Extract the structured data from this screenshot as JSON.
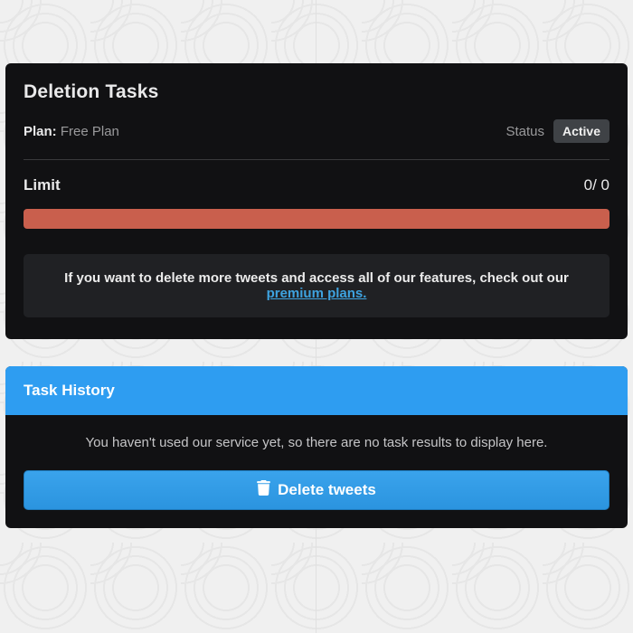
{
  "deletion": {
    "title": "Deletion Tasks",
    "plan_label": "Plan:",
    "plan_value": "Free Plan",
    "status_label": "Status",
    "status_value": "Active",
    "limit_label": "Limit",
    "limit_used": 0,
    "limit_total": 0,
    "limit_display": "0/ 0",
    "progress_color": "#c95f4d",
    "notice_prefix": "If you want to delete more tweets and access all of our features, check out our ",
    "notice_link_text": "premium plans."
  },
  "history": {
    "title": "Task History",
    "empty_message": "You haven't used our service yet, so there are no task results to display here.",
    "button_label": "Delete tweets"
  }
}
